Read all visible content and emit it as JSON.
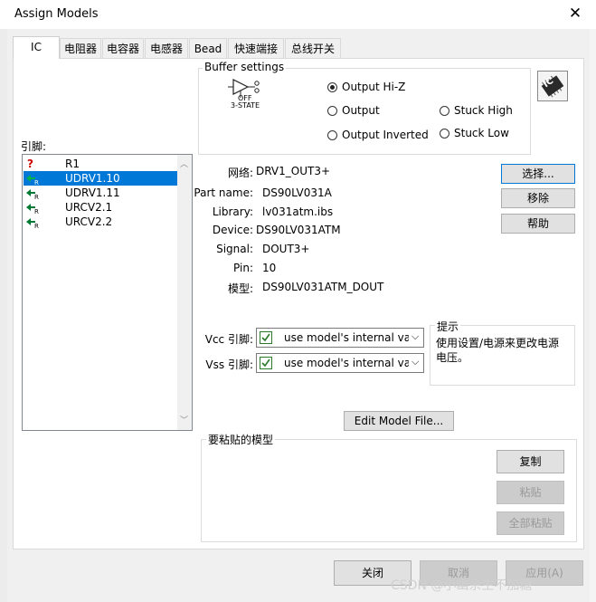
{
  "window": {
    "title": "Assign Models",
    "close_glyph": "✕"
  },
  "tabs": [
    {
      "label": "IC"
    },
    {
      "label": "电阻器"
    },
    {
      "label": "电容器"
    },
    {
      "label": "电感器"
    },
    {
      "label": "Bead"
    },
    {
      "label": "快速端接"
    },
    {
      "label": "总线开关"
    }
  ],
  "buffer": {
    "title": "Buffer settings",
    "icon_label_off": "OFF",
    "icon_label_state": "3-STATE",
    "options": [
      {
        "label": "Output Hi-Z",
        "checked": true
      },
      {
        "label": "Output",
        "checked": false
      },
      {
        "label": "Output Inverted",
        "checked": false
      },
      {
        "label": "Stuck High",
        "checked": false
      },
      {
        "label": "Stuck Low",
        "checked": false
      }
    ],
    "ic_badge": "IC"
  },
  "pins": {
    "label": "引脚:",
    "items": [
      {
        "name": "R1",
        "icon": "question-icon"
      },
      {
        "name": "UDRV1.10",
        "icon": "driver-pin-icon",
        "selected": true
      },
      {
        "name": "UDRV1.11",
        "icon": "driver-pin-icon"
      },
      {
        "name": "URCV2.1",
        "icon": "driver-pin-icon"
      },
      {
        "name": "URCV2.2",
        "icon": "driver-pin-icon"
      }
    ]
  },
  "details": {
    "net_label": "网络:",
    "net_value": "DRV1_OUT3+",
    "part_label": "Part name:",
    "part_value": "DS90LV031A",
    "library_label": "Library:",
    "library_value": "lv031atm.ibs",
    "device_label": "Device:",
    "device_value": "DS90LV031ATM",
    "signal_label": "Signal:",
    "signal_value": "DOUT3+",
    "pin_label": "Pin:",
    "pin_value": "10",
    "model_label": "模型:",
    "model_value": "DS90LV031ATM_DOUT"
  },
  "side_buttons": {
    "select": "选择...",
    "remove": "移除",
    "help": "帮助"
  },
  "supply": {
    "vcc_label": "Vcc 引脚:",
    "vcc_value": "use model's internal va",
    "vss_label": "Vss 引脚:",
    "vss_value": "use model's internal va"
  },
  "hint": {
    "title": "提示",
    "text": "使用设置/电源来更改电源电压。"
  },
  "edit_model_button": "Edit Model File...",
  "paste": {
    "title": "要粘贴的模型",
    "copy": "复制",
    "paste": "粘贴",
    "paste_all": "全部粘贴"
  },
  "footer": {
    "close": "关闭",
    "cancel": "取消",
    "apply": "应用(A)"
  },
  "watermark": "CSDN @小幽余生不加糖"
}
